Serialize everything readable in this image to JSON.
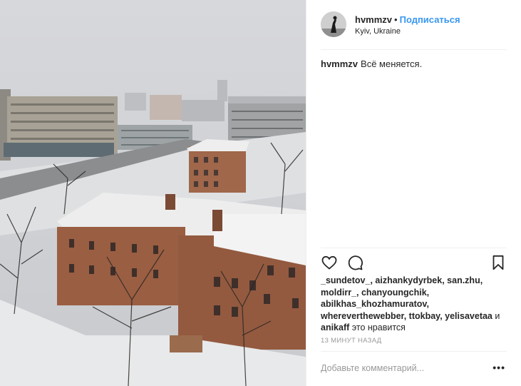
{
  "post": {
    "username": "hvmmzv",
    "separator": "•",
    "follow_label": "Подписаться",
    "location": "Kyiv, Ukraine",
    "caption_user": "hvmmzv",
    "caption_text": "Всё меняется.",
    "likes_users": [
      "_sundetov_",
      "aizhankydyrbek",
      "san.zhu",
      "moldirr_",
      "chanyoungchik",
      "abilkhas_khozhamuratov",
      "whereverthewebber",
      "ttokbay",
      "yelisavetaa",
      "anikaff"
    ],
    "likes_and": "и",
    "likes_suffix": "это нравится",
    "timestamp": "13 МИНУТ НАЗАД",
    "comment_placeholder": "Добавьте комментарий...",
    "more_label": "•••"
  },
  "icons": [
    "heart-icon",
    "comment-icon",
    "bookmark-icon"
  ],
  "colors": {
    "link": "#3897f0",
    "text": "#262626",
    "muted": "#999999",
    "border": "#efefef"
  }
}
